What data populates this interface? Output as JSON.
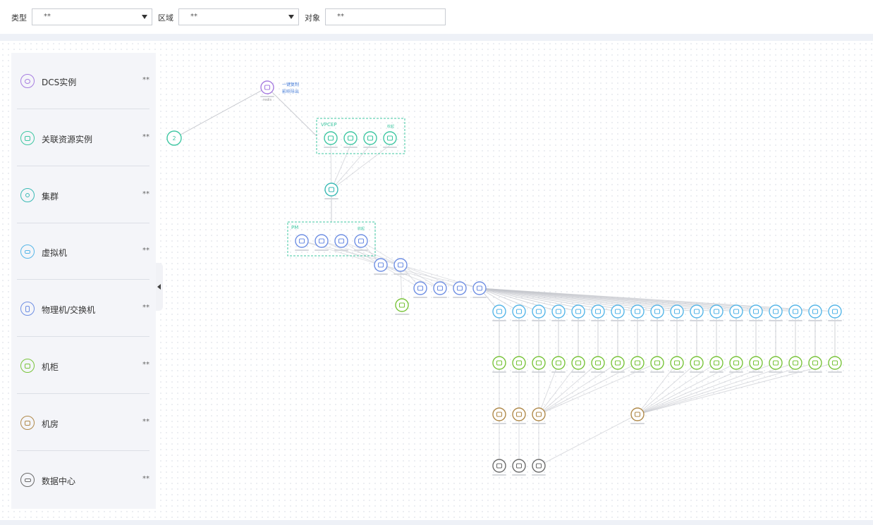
{
  "filters": {
    "type_label": "类型",
    "type_value": "**",
    "region_label": "区域",
    "region_value": "**",
    "object_label": "对象",
    "object_value": "**"
  },
  "legend": {
    "items": [
      {
        "label": "DCS实例",
        "count": "**",
        "color": "#a77de0",
        "icon": "dcs-instance-icon"
      },
      {
        "label": "关联资源实例",
        "count": "**",
        "color": "#3fc7a2",
        "icon": "related-resource-icon"
      },
      {
        "label": "集群",
        "count": "**",
        "color": "#3bbab5",
        "icon": "cluster-icon"
      },
      {
        "label": "虚拟机",
        "count": "**",
        "color": "#56b6e8",
        "icon": "vm-icon"
      },
      {
        "label": "物理机/交换机",
        "count": "**",
        "color": "#6f8fe3",
        "icon": "physical-machine-icon"
      },
      {
        "label": "机柜",
        "count": "**",
        "color": "#79c43b",
        "icon": "cabinet-icon"
      },
      {
        "label": "机房",
        "count": "**",
        "color": "#b08a4a",
        "icon": "server-room-icon"
      },
      {
        "label": "数据中心",
        "count": "**",
        "color": "#6b6b6b",
        "icon": "datacenter-icon"
      }
    ]
  },
  "topology": {
    "root_label": "redis",
    "root_actions": [
      "一键复制",
      "影响导出"
    ],
    "collapsed_count": "2",
    "vpcep_group_title": "VPCEP",
    "vpcep_group_action": "收起",
    "pm_group_title": "PM",
    "pm_group_action": "收起",
    "colors": {
      "dcs": "#a77de0",
      "related": "#3fc7a2",
      "cluster": "#3bbab5",
      "vm": "#56b6e8",
      "pm": "#6f8fe3",
      "cabinet": "#79c43b",
      "room": "#b08a4a",
      "dc": "#6b6b6b",
      "edge": "#c4c6cc"
    }
  }
}
